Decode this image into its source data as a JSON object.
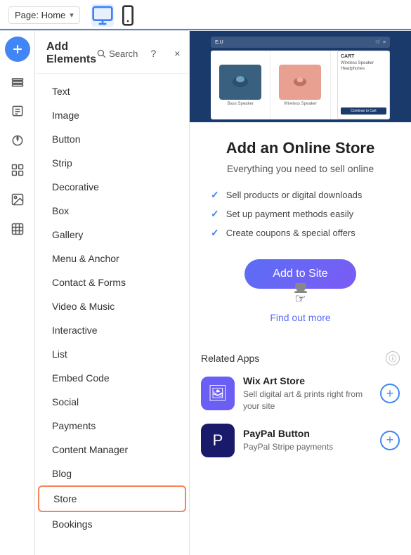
{
  "topbar": {
    "page_label": "Page: Home",
    "chevron": "▾",
    "search_placeholder": "Search"
  },
  "panel": {
    "title": "Add Elements",
    "search_label": "Search",
    "close_label": "×",
    "help_label": "?",
    "nav_items": [
      {
        "id": "text",
        "label": "Text"
      },
      {
        "id": "image",
        "label": "Image"
      },
      {
        "id": "button",
        "label": "Button"
      },
      {
        "id": "strip",
        "label": "Strip"
      },
      {
        "id": "decorative",
        "label": "Decorative"
      },
      {
        "id": "box",
        "label": "Box"
      },
      {
        "id": "gallery",
        "label": "Gallery"
      },
      {
        "id": "menu-anchor",
        "label": "Menu & Anchor"
      },
      {
        "id": "contact-forms",
        "label": "Contact & Forms"
      },
      {
        "id": "video-music",
        "label": "Video & Music"
      },
      {
        "id": "interactive",
        "label": "Interactive"
      },
      {
        "id": "list",
        "label": "List"
      },
      {
        "id": "embed-code",
        "label": "Embed Code"
      },
      {
        "id": "social",
        "label": "Social"
      },
      {
        "id": "payments",
        "label": "Payments"
      },
      {
        "id": "content-manager",
        "label": "Content Manager"
      },
      {
        "id": "blog",
        "label": "Blog"
      },
      {
        "id": "store",
        "label": "Store"
      },
      {
        "id": "bookings",
        "label": "Bookings"
      }
    ]
  },
  "store_panel": {
    "hero_brand": "E.U",
    "hero_products": [
      {
        "label": "Bass Speaker"
      },
      {
        "label": "Wireless Speaker"
      },
      {
        "label": "Headphones"
      }
    ],
    "hero_cart_title": "CART",
    "hero_cart_items": [
      {
        "name": "Wireless Speaker"
      },
      {
        "name": "Headphones"
      },
      {
        "name": "Continue to Cart"
      }
    ],
    "title": "Add an Online Store",
    "subtitle": "Everything you need to sell online",
    "features": [
      "Sell products or digital downloads",
      "Set up payment methods easily",
      "Create coupons & special offers"
    ],
    "add_button_label": "Add to Site",
    "find_out_more_label": "Find out more",
    "related_apps_title": "Related Apps",
    "apps": [
      {
        "id": "wix-art-store",
        "name": "Wix Art Store",
        "description": "Sell digital art & prints right from your site",
        "icon": "🖼"
      },
      {
        "id": "paypal-button",
        "name": "PayPal Button",
        "description": "PayPal Stripe payments",
        "icon": "P"
      }
    ]
  },
  "colors": {
    "accent_blue": "#4285f4",
    "accent_purple": "#6b5ef5",
    "store_selected_border": "#f5845a",
    "hero_bg": "#1a3a6b"
  }
}
